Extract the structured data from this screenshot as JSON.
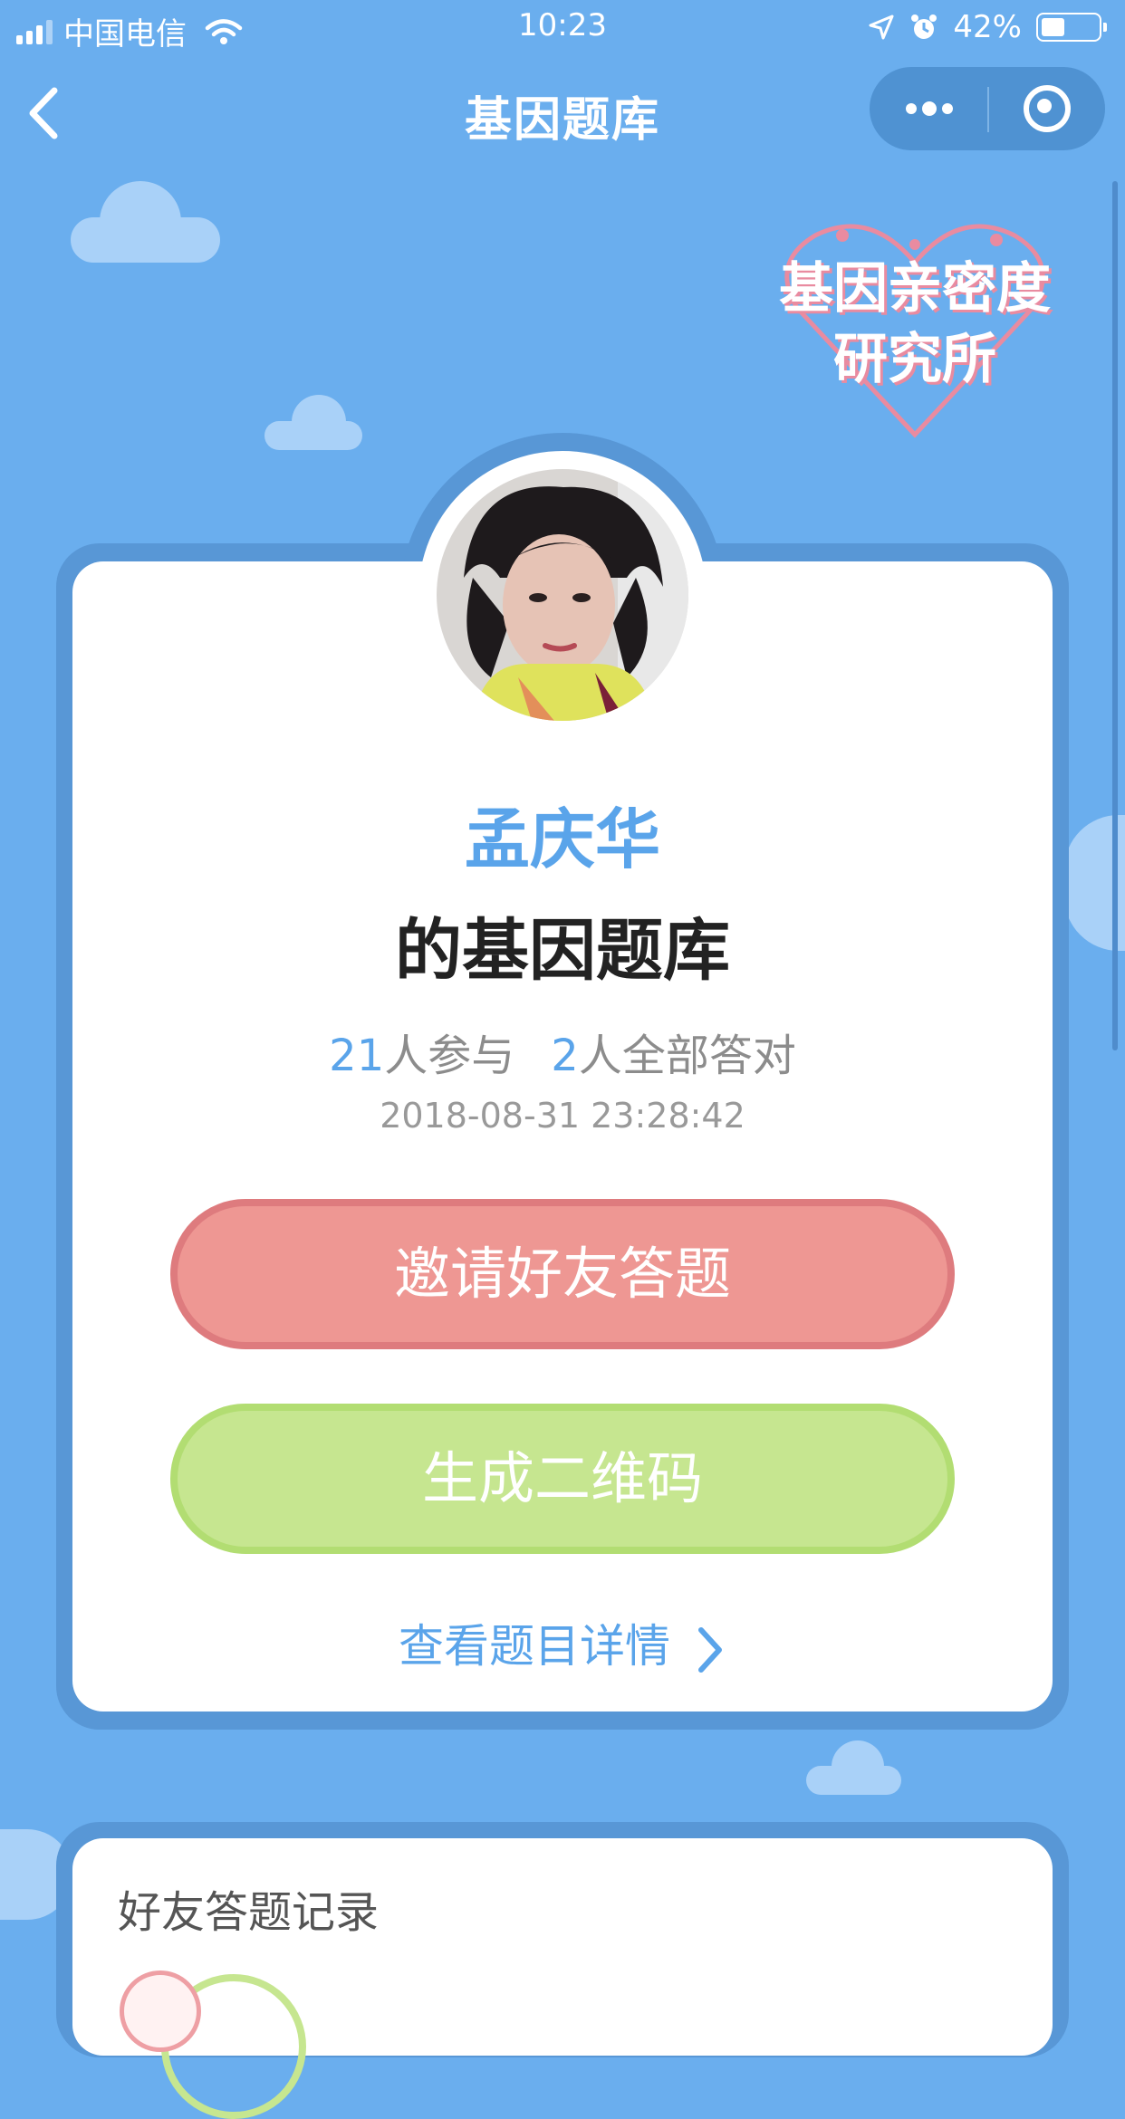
{
  "status_bar": {
    "carrier": "中国电信",
    "time": "10:23",
    "battery": "42%",
    "battery_level": 0.42,
    "signal_bars_filled": 3,
    "signal_bars_total": 4
  },
  "nav": {
    "title": "基因题库",
    "back_icon": "chevron-left-icon",
    "more_icon": "more-dots-icon",
    "close_icon": "target-close-icon"
  },
  "logo": {
    "line1": "基因亲密度",
    "line2": "研究所"
  },
  "profile": {
    "name": "孟庆华",
    "bank_title": "的基因题库",
    "participants_count": "21",
    "participants_label": "人参与",
    "all_correct_count": "2",
    "all_correct_label": "人全部答对",
    "created_at": "2018-08-31 23:28:42"
  },
  "actions": {
    "invite_label": "邀请好友答题",
    "qr_label": "生成二维码",
    "details_label": "查看题目详情"
  },
  "records": {
    "title": "好友答题记录"
  },
  "colors": {
    "background": "#6aaeee",
    "accent_blue": "#5aa4ea",
    "invite_red": "#ee9793",
    "qr_green": "#c6e690",
    "frame_blue": "#5897d6"
  }
}
